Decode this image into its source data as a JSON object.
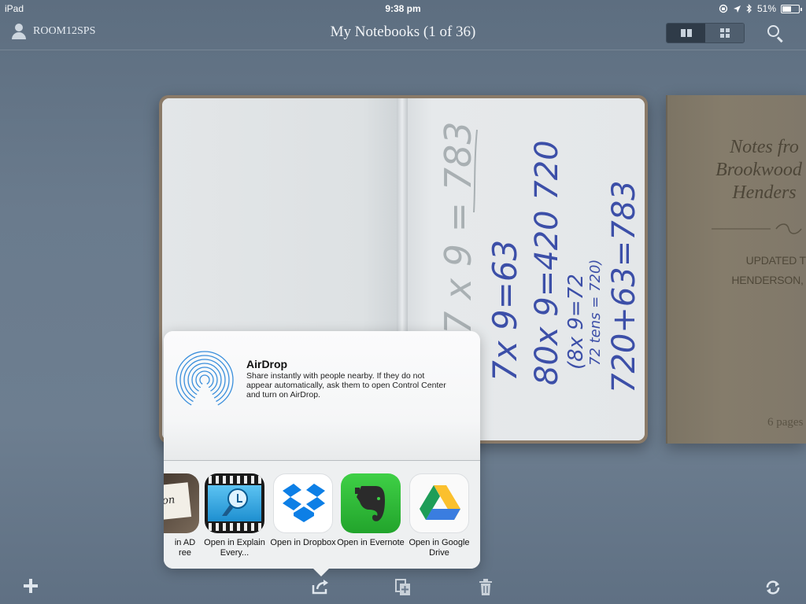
{
  "status_bar": {
    "device": "iPad",
    "time": "9:38 pm",
    "battery": "51%",
    "battery_level": 0.51
  },
  "nav": {
    "user": "ROOM12SPS",
    "title": "My Notebooks (1 of 36)"
  },
  "notebook": {
    "handwriting": {
      "line1": "7 x 9 = 783",
      "line2": "7x 9=63",
      "line3": "80x 9=420 720",
      "line4": "(8x 9=72",
      "line5": "72 tens = 720)",
      "line6": "720+63=783"
    }
  },
  "next_notebook": {
    "title_lines": [
      "Notes fro",
      "Brookwood I",
      "Henders"
    ],
    "updated_line1": "UPDATED TO",
    "updated_line2": "HENDERSON, NEV",
    "pages": "6 pages"
  },
  "share_sheet": {
    "airdrop_title": "AirDrop",
    "airdrop_desc": "Share instantly with people nearby. If they do not appear automatically, ask them to open Control Center and turn on AirDrop.",
    "apps": [
      {
        "label": "in AD\nree",
        "icon": "ad-app-icon"
      },
      {
        "label": "Open in Explain Every...",
        "icon": "explain-everything-icon"
      },
      {
        "label": "Open in Dropbox",
        "icon": "dropbox-icon"
      },
      {
        "label": "Open in Evernote",
        "icon": "evernote-icon"
      },
      {
        "label": "Open in Google Drive",
        "icon": "google-drive-icon"
      }
    ]
  },
  "colors": {
    "background": "#6a7b8d",
    "dropbox_blue": "#0d7fe6",
    "evernote_green": "#2fbd38",
    "handwriting_blue": "#3c4fa8"
  }
}
